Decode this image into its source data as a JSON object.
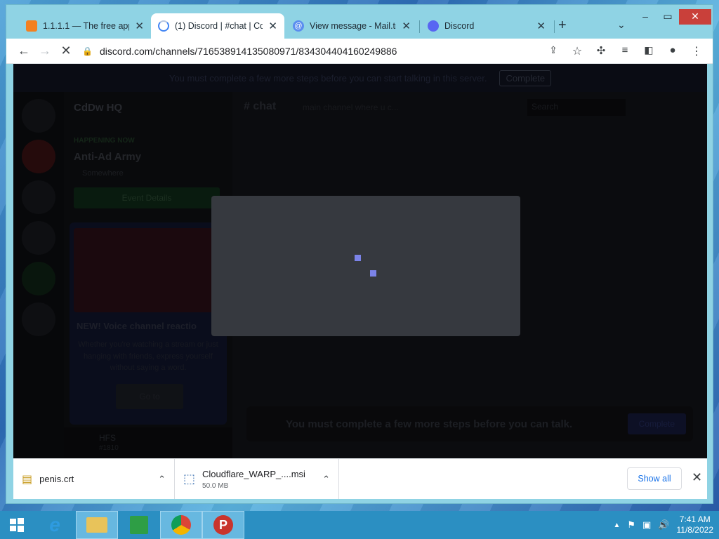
{
  "browser": {
    "tabs": [
      {
        "label": "1.1.1.1 — The free app t",
        "favicon": "cloudflare-1111-icon",
        "active": false
      },
      {
        "label": "(1) Discord | #chat | CdD",
        "favicon": "chrome-loading-icon",
        "active": true
      },
      {
        "label": "View message - Mail.tm",
        "favicon": "at-sign-icon",
        "active": false
      },
      {
        "label": "Discord",
        "favicon": "discord-icon",
        "active": false
      }
    ],
    "url": "discord.com/channels/716538914135080971/834304404160249886"
  },
  "discord": {
    "notice_text": "You must complete a few more steps before you can start talking in this server.",
    "notice_button": "Complete",
    "server_name": "CdDw HQ",
    "event_tag": "HAPPENING NOW",
    "event_name": "Anti-Ad Army",
    "event_location": "Somewhere",
    "event_button": "Event Details",
    "promo_badge": "NEW",
    "promo_title": "NEW! Voice channel reactio",
    "promo_body": "Whether you're watching a stream or just hanging with friends, express yourself without saying a word.",
    "promo_button": "Go to",
    "username": "HFS",
    "user_tag": "#1810",
    "channel_name": "chat",
    "channel_topic": "main channel where u c...",
    "search_placeholder": "Search",
    "gate_text": "You must complete a few more steps before you can talk.",
    "gate_button": "Complete"
  },
  "downloads": {
    "items": [
      {
        "name": "penis.crt",
        "size": ""
      },
      {
        "name": "Cloudflare_WARP_....msi",
        "size": "50.0 MB"
      }
    ],
    "show_all": "Show all"
  },
  "taskbar": {
    "time": "7:41 AM",
    "date": "11/8/2022"
  },
  "colors": {
    "spinner": "#7b83e8",
    "modal_bg": "#36393f",
    "window_frame": "#8fd3e4"
  }
}
